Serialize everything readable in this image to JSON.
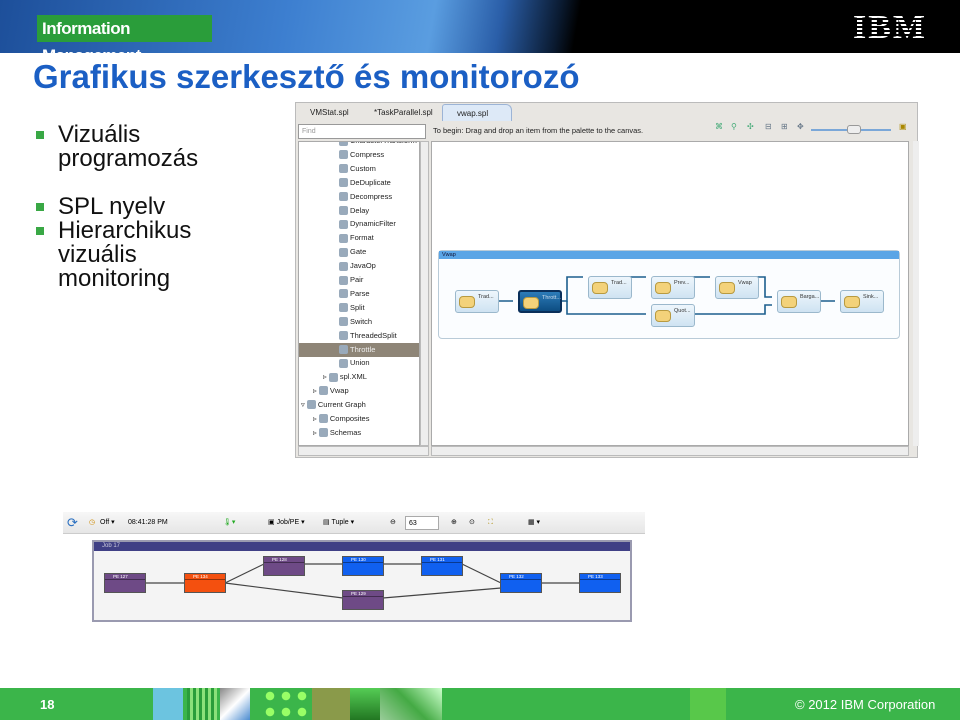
{
  "header": {
    "badge": "Information Management",
    "logo": "IBM"
  },
  "title": "Grafikus szerkesztő és monitorozó",
  "bullets": [
    [
      "Vizuális",
      "programozás"
    ],
    [
      "SPL nyelv"
    ],
    [
      "Hierarchikus",
      "vizuális",
      "monitoring"
    ]
  ],
  "editor": {
    "tabs": [
      "VMStat.spl",
      "*TaskParallel.spl",
      "vwap.spl"
    ],
    "find_placeholder": "Find",
    "hint": "To begin:  Drag and drop an item from  the palette to the canvas.",
    "palette": [
      "CharacterTransform",
      "Compress",
      "Custom",
      "DeDuplicate",
      "Decompress",
      "Delay",
      "DynamicFilter",
      "Format",
      "Gate",
      "JavaOp",
      "Pair",
      "Parse",
      "Split",
      "Switch",
      "ThreadedSplit",
      "Throttle",
      "Union"
    ],
    "selected_palette_item": "Throttle",
    "tree": [
      "spl.XML",
      "Vwap",
      "Current Graph",
      "Composites",
      "Schemas"
    ],
    "composite_title": "Vwap",
    "nodes": [
      "Trad...",
      "Thrott...",
      "Trad...",
      "Prev...",
      "Vwap",
      "Quot...",
      "Barga...",
      "Sink..."
    ]
  },
  "monitor": {
    "toolbar": {
      "refresh": "refresh-icon",
      "auto_refresh": "Off",
      "time": "08:41:28 PM",
      "group": "Job/PE",
      "tuple": "Tuple",
      "zoom": "63"
    },
    "job_title": "Job 17",
    "pes": [
      {
        "label": "PE 127",
        "color": "#6e4a86"
      },
      {
        "label": "PE 134",
        "color": "#f4500f"
      },
      {
        "label": "PE 128",
        "color": "#6e4a86"
      },
      {
        "label": "PE 130",
        "color": "#1060f0"
      },
      {
        "label": "PE 131",
        "color": "#1060f0"
      },
      {
        "label": "PE 129",
        "color": "#6e4a86"
      },
      {
        "label": "PE 132",
        "color": "#1060f0"
      },
      {
        "label": "PE 133",
        "color": "#1060f0"
      }
    ]
  },
  "footer": {
    "page": "18",
    "copyright": "© 2012 IBM Corporation"
  }
}
